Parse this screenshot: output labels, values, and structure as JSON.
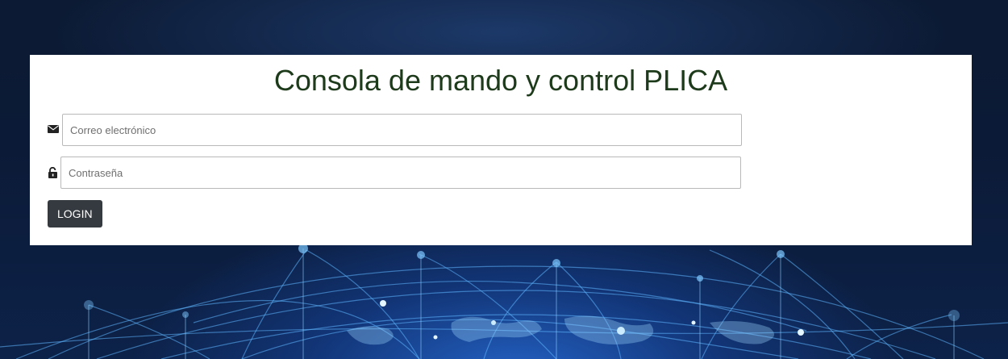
{
  "page": {
    "title": "Consola de mando y control PLICA"
  },
  "form": {
    "email": {
      "icon": "envelope-icon",
      "placeholder": "Correo electrónico",
      "value": ""
    },
    "password": {
      "icon": "unlock-icon",
      "placeholder": "Contraseña",
      "value": ""
    },
    "login_label": "LOGIN"
  },
  "colors": {
    "title": "#1d3a1a",
    "button_bg": "#343a40",
    "panel_bg": "#ffffff",
    "page_bg": "#0c1a33"
  }
}
